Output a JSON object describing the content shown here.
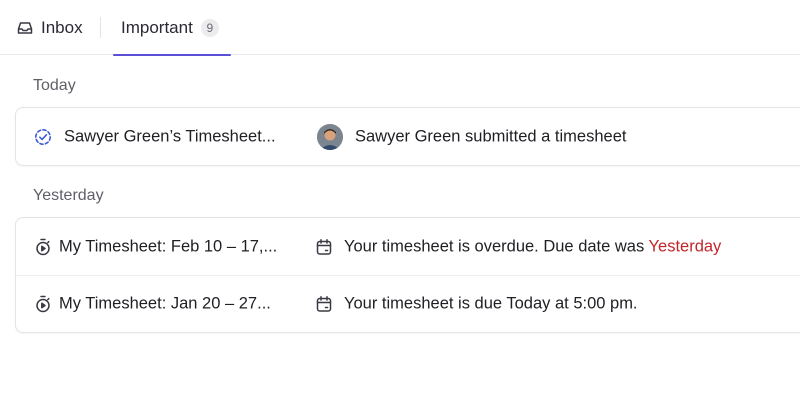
{
  "tabs": {
    "inbox": {
      "label": "Inbox",
      "icon": "inbox-icon"
    },
    "important": {
      "label": "Important",
      "count": "9",
      "icon": null
    }
  },
  "accent_color": "#5b4fd6",
  "sections": [
    {
      "label": "Today",
      "rows": [
        {
          "icon": "timesheet-submitted-icon",
          "title": "Sawyer Green’s Timesheet...",
          "meta_icon": "avatar",
          "text": "Sawyer Green submitted a timesheet"
        }
      ]
    },
    {
      "label": "Yesterday",
      "rows": [
        {
          "icon": "stopwatch-icon",
          "title": "My Timesheet: Feb 10 – 17,...",
          "meta_icon": "calendar-icon",
          "text": "Your timesheet is overdue. Due date was ",
          "text_highlight": "Yesterday",
          "highlight_color": "#c3262b"
        },
        {
          "icon": "stopwatch-icon",
          "title": "My Timesheet: Jan 20 – 27...",
          "meta_icon": "calendar-icon",
          "text": "Your timesheet is due Today at 5:00 pm."
        }
      ]
    }
  ]
}
